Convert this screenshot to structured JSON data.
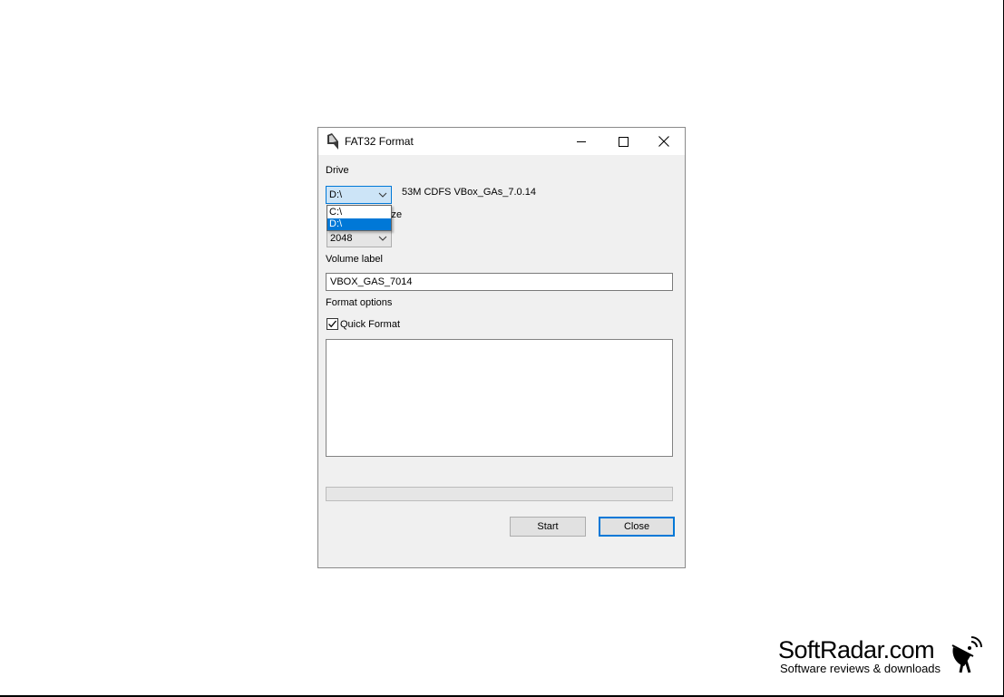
{
  "window": {
    "title": "FAT32 Format",
    "title_icon": "app-icon",
    "controls": [
      "minimize-icon",
      "maximize-icon",
      "close-icon"
    ]
  },
  "drive": {
    "label": "Drive",
    "selected": "D:\\",
    "info": "53M CDFS VBox_GAs_7.0.14",
    "options": [
      "C:\\",
      "D:\\"
    ],
    "highlighted": "D:\\"
  },
  "allocation": {
    "label_partial": "ize",
    "selected": "2048"
  },
  "volume": {
    "label": "Volume label",
    "value": "VBOX_GAS_7014"
  },
  "format_options": {
    "label": "Format options",
    "quick_format_label": "Quick Format",
    "quick_format_checked": true
  },
  "log": {
    "text": ""
  },
  "progress": {
    "value": 0
  },
  "buttons": {
    "start": "Start",
    "close": "Close"
  },
  "watermark": {
    "title": "SoftRadar.com",
    "subtitle": "Software reviews & downloads",
    "icon": "satellite-dish-icon"
  },
  "colors": {
    "accent": "#0078d7",
    "dialog_bg": "#f0f0f0",
    "selected_combo_bg": "#cce4f7"
  }
}
